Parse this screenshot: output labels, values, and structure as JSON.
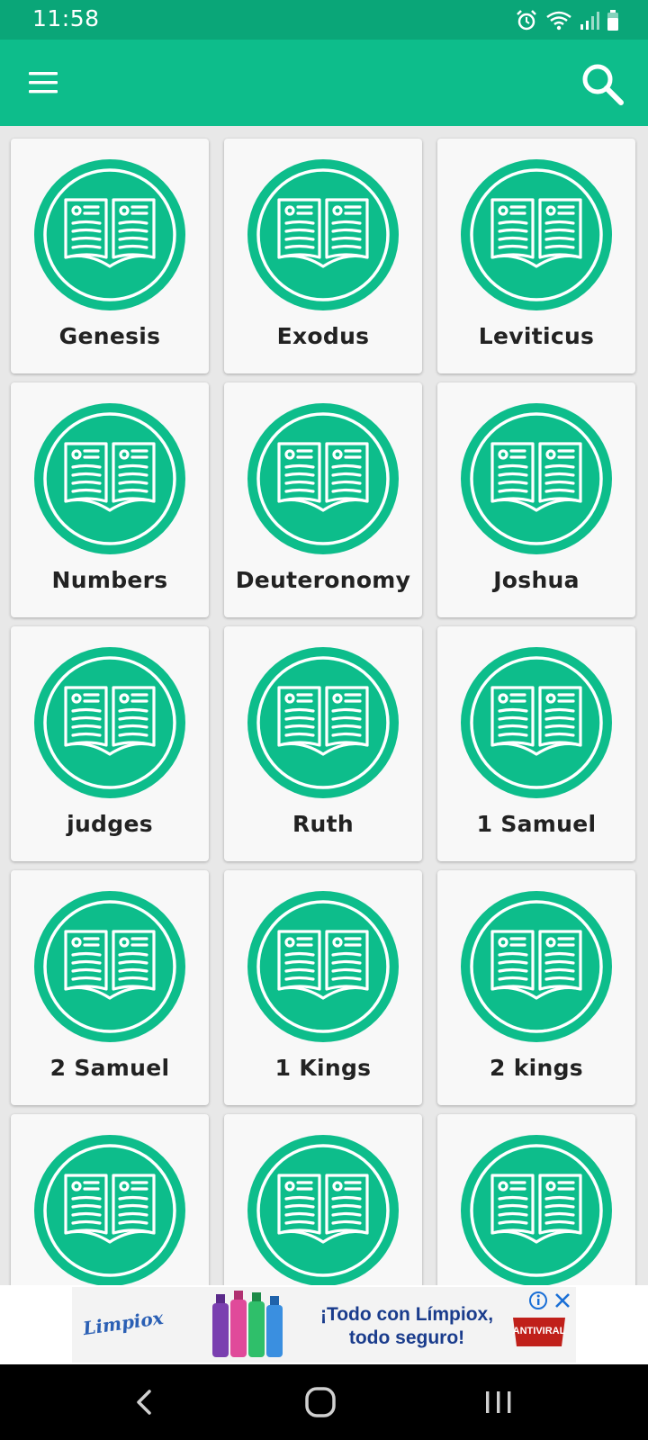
{
  "status_bar": {
    "time": "11:58",
    "icons": [
      "alarm-icon",
      "wifi-icon",
      "signal-icon",
      "battery-icon"
    ]
  },
  "app_bar": {
    "menu_icon": "hamburger-menu-icon",
    "search_icon": "search-icon",
    "color": "#0dbd8b"
  },
  "books": [
    {
      "label": "Genesis"
    },
    {
      "label": "Exodus"
    },
    {
      "label": "Leviticus"
    },
    {
      "label": "Numbers"
    },
    {
      "label": "Deuteronomy"
    },
    {
      "label": "Joshua"
    },
    {
      "label": "judges"
    },
    {
      "label": "Ruth"
    },
    {
      "label": "1 Samuel"
    },
    {
      "label": "2 Samuel"
    },
    {
      "label": "1 Kings"
    },
    {
      "label": "2 kings"
    },
    {
      "label": ""
    },
    {
      "label": ""
    },
    {
      "label": ""
    }
  ],
  "ad": {
    "brand": "Limpiox",
    "text_line1": "¡Todo con Límpiox,",
    "text_line2": "todo seguro!",
    "badge": "ANTIVIRAL"
  },
  "colors": {
    "accent": "#0dbd8b",
    "status_bar": "#0aa678",
    "card_bg": "#f8f8f8",
    "text": "#222222"
  }
}
